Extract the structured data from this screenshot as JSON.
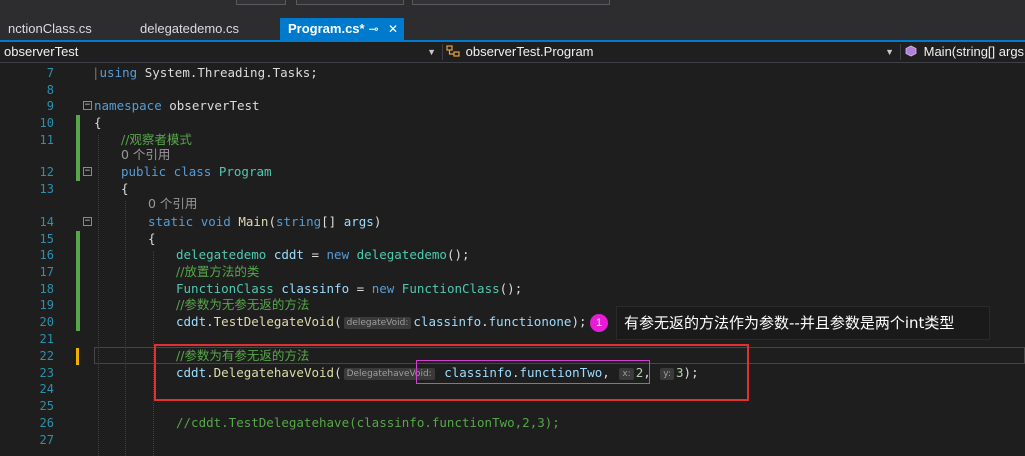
{
  "tabs": [
    {
      "label": "nctionClass.cs",
      "active": false
    },
    {
      "label": "delegatedemo.cs",
      "active": false
    },
    {
      "label": "Program.cs*",
      "active": true
    }
  ],
  "active_tab_icons": {
    "pin": "⊸",
    "close": "✕"
  },
  "nav": {
    "project": "observerTest",
    "class": "observerTest.Program",
    "member": "Main(string[] args"
  },
  "editor": {
    "lines": [
      {
        "n": "7"
      },
      {
        "n": "8"
      },
      {
        "n": "9"
      },
      {
        "n": "10"
      },
      {
        "n": "11"
      },
      {
        "n": "12"
      },
      {
        "n": "13"
      },
      {
        "n": "14"
      },
      {
        "n": "15"
      },
      {
        "n": "16"
      },
      {
        "n": "17"
      },
      {
        "n": "18"
      },
      {
        "n": "19"
      },
      {
        "n": "20"
      },
      {
        "n": "21"
      },
      {
        "n": "22"
      },
      {
        "n": "23"
      },
      {
        "n": "24"
      },
      {
        "n": "25"
      },
      {
        "n": "26"
      },
      {
        "n": "27"
      }
    ],
    "code": {
      "l7_kw": "using",
      "l7_rest": " System.Threading.Tasks;",
      "l9_kw": "namespace",
      "l9_rest": " observerTest",
      "l10": "{",
      "l11_comment": "//观察者模式",
      "refs_class": "0 个引用",
      "l12_kw": "public class",
      "l12_type": "Program",
      "l13": "{",
      "refs_main": "0 个引用",
      "l14_kw1": "static",
      "l14_kw2": "void",
      "l14_method": "Main",
      "l14_open": "(",
      "l14_kw3": "string",
      "l14_mid": "[] ",
      "l14_param": "args",
      "l14_close": ")",
      "l15": "{",
      "l16_type": "delegatedemo",
      "l16_var": "cddt",
      "l16_eq": " = ",
      "l16_new": "new",
      "l16_ctor": "delegatedemo",
      "l16_end": "();",
      "l17_comment": "//放置方法的类",
      "l18_type": "FunctionClass",
      "l18_var": "classinfo",
      "l18_eq": " = ",
      "l18_new": "new",
      "l18_ctor": "FunctionClass",
      "l18_end": "();",
      "l19_comment": "//参数为无参无返的方法",
      "l20_var": "cddt",
      "l20_dot": ".",
      "l20_method": "TestDelegateVoid",
      "l20_open": "(",
      "l20_hint": "delegateVoid:",
      "l20_arg": "classinfo",
      "l20_arg_dot": ".",
      "l20_arg_member": "functionone",
      "l20_end": ");",
      "l22_comment": "//参数为有参无返的方法",
      "l23_var": "cddt",
      "l23_dot": ".",
      "l23_method": "DelegatehaveVoid",
      "l23_open": "(",
      "l23_hint": "DelegatehaveVoid:",
      "l23_arg": "classinfo",
      "l23_arg_dot": ".",
      "l23_arg_member": "functionTwo",
      "l23_comma1": ", ",
      "l23_hint_x": "x:",
      "l23_x": "2",
      "l23_comma2": ", ",
      "l23_hint_y": "y:",
      "l23_y": "3",
      "l23_end": ");",
      "l26_comment": "//cddt.TestDelegatehave(classinfo.functionTwo,2,3);"
    }
  },
  "annotation": {
    "badge": "1",
    "text": "有参无返的方法作为参数--并且参数是两个int类型"
  },
  "colors": {
    "keyword": "#569cd6",
    "type": "#4ec9b0",
    "comment": "#57a64a",
    "identifier": "#9cdcfe",
    "method": "#dcdcaa",
    "number": "#b5cea8",
    "line_number": "#2b91af",
    "tab_active": "#007acc",
    "highlight_box": "#e03131",
    "param_box": "#d23fd2",
    "badge": "#e81cd6"
  }
}
